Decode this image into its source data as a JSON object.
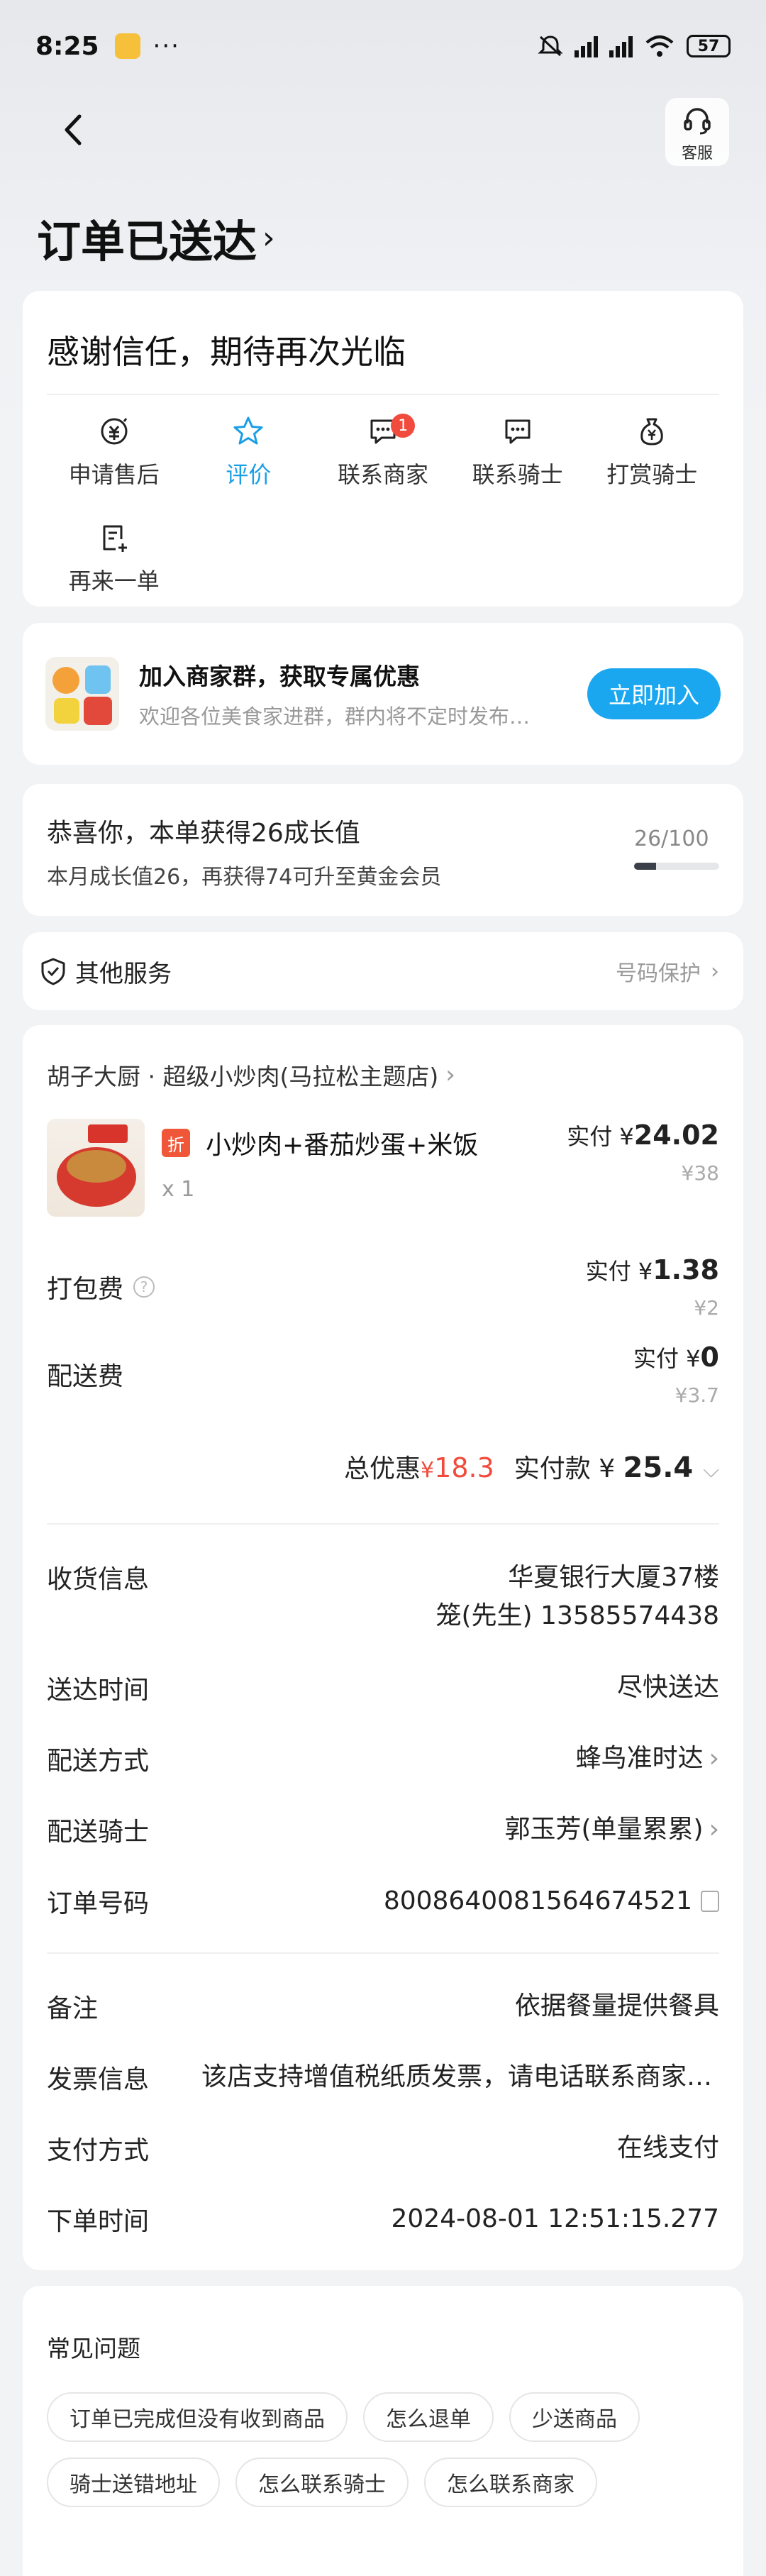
{
  "status_bar": {
    "time": "8:25",
    "battery": "57"
  },
  "nav": {
    "kefu_label": "客服"
  },
  "title": "订单已送达",
  "thanks": "感谢信任，期待再次光临",
  "actions": [
    {
      "label": "申请售后",
      "icon": "after-sale-icon"
    },
    {
      "label": "评价",
      "icon": "star-icon"
    },
    {
      "label": "联系商家",
      "icon": "chat-icon",
      "badge": "1"
    },
    {
      "label": "联系骑士",
      "icon": "chat-icon"
    },
    {
      "label": "打赏骑士",
      "icon": "money-bag-icon"
    },
    {
      "label": "再来一单",
      "icon": "reorder-icon"
    }
  ],
  "group": {
    "title": "加入商家群，获取专属优惠",
    "subtitle": "欢迎各位美食家进群，群内将不定时发布…",
    "button": "立即加入"
  },
  "growth": {
    "title": "恭喜你，本单获得26成长值",
    "subtitle": "本月成长值26，再获得74可升至黄金会员",
    "count": "26/100",
    "progress": 0.26
  },
  "services": {
    "title": "其他服务",
    "right": "号码保护"
  },
  "order": {
    "shop": "胡子大厨 · 超级小炒肉(马拉松主题店)",
    "item": {
      "tag": "折",
      "name": "小炒肉+番茄炒蛋+米饭",
      "qty": "x 1",
      "paid_prefix": "实付 ¥",
      "paid": "24.02",
      "orig": "¥38"
    },
    "packing": {
      "label": "打包费",
      "paid_prefix": "实付 ¥",
      "paid": "1.38",
      "orig": "¥2"
    },
    "delivery": {
      "label": "配送费",
      "paid_prefix": "实付 ¥",
      "paid": "0",
      "orig": "¥3.7"
    },
    "totals": {
      "discount_label": "总优惠",
      "discount_currency": "¥",
      "discount": "18.3",
      "paid_label": "实付款 ¥ ",
      "paid": "25.4"
    },
    "info": {
      "address_label": "收货信息",
      "address": "华夏银行大厦37楼",
      "contact": "笼(先生) 13585574438",
      "time_label": "送达时间",
      "time": "尽快送达",
      "method_label": "配送方式",
      "method": "蜂鸟准时达",
      "rider_label": "配送骑士",
      "rider": "郭玉芳(单量累累)",
      "order_no_label": "订单号码",
      "order_no": "8008640081564674521",
      "note_label": "备注",
      "note": "依据餐量提供餐具",
      "invoice_label": "发票信息",
      "invoice": "该店支持增值税纸质发票，请电话联系商家开具",
      "pay_label": "支付方式",
      "pay": "在线支付",
      "order_time_label": "下单时间",
      "order_time": "2024-08-01 12:51:15.277"
    }
  },
  "faq": {
    "title": "常见问题",
    "tags": [
      "订单已完成但没有收到商品",
      "怎么退单",
      "少送商品",
      "骑士送错地址",
      "怎么联系骑士",
      "怎么联系商家"
    ]
  },
  "colors": {
    "accent": "#1aa7f0",
    "discount": "#f04b3c",
    "badge": "#f04b3c"
  }
}
